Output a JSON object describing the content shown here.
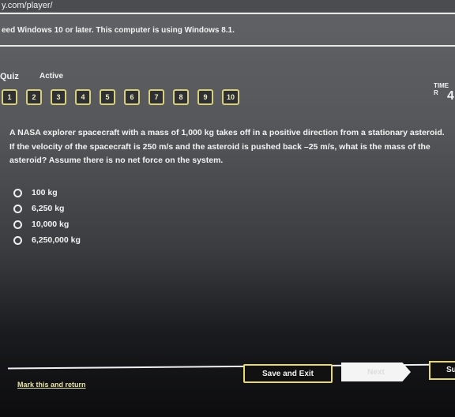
{
  "browser": {
    "url": "y.com/player/"
  },
  "warning": {
    "text": "eed Windows 10 or later. This computer is using Windows 8.1."
  },
  "quiz": {
    "title": "Quiz",
    "status": "Active",
    "questions": [
      "1",
      "2",
      "3",
      "4",
      "5",
      "6",
      "7",
      "8",
      "9",
      "10"
    ],
    "time_label": "TIME R",
    "time_value": "4"
  },
  "question": {
    "lines": [
      "A NASA explorer spacecraft with a mass of 1,000 kg takes off in a positive direction from a stationary asteroid.",
      "If the velocity of the spacecraft is 250 m/s and the asteroid is pushed back –25 m/s, what is the mass of the",
      "asteroid? Assume there is no net force on the system."
    ]
  },
  "options": [
    "100 kg",
    "6,250 kg",
    "10,000 kg",
    "6,250,000 kg"
  ],
  "footer": {
    "mark_label": "Mark this and return",
    "save_label": "Save and Exit",
    "next_label": "Next",
    "submit_label": "Submit"
  },
  "colors": {
    "accent": "#e8d870"
  }
}
